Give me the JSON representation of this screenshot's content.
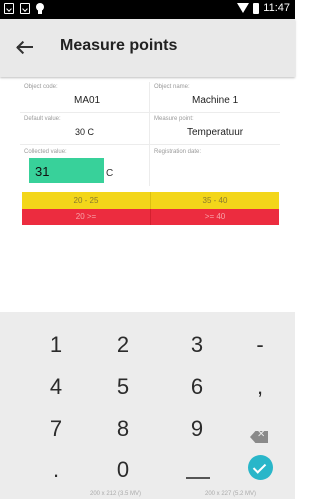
{
  "status_bar": {
    "time": "11:47",
    "left_icons": [
      "screenshot-icon",
      "screenshot-icon",
      "bulb-icon"
    ],
    "right_icons": [
      "wifi-icon",
      "battery-icon"
    ]
  },
  "app_bar": {
    "title": "Measure points",
    "back_icon": "arrow-left-icon"
  },
  "fields": {
    "object_code": {
      "label": "Object code:",
      "value": "MA01"
    },
    "object_name": {
      "label": "Object name:",
      "value": "Machine 1"
    },
    "default_value": {
      "label": "Default value:",
      "value": "30 C"
    },
    "measure_point": {
      "label": "Measure point:",
      "value": "Temperatuur"
    },
    "collected_value": {
      "label": "Collected value:",
      "value": "31",
      "unit": "C"
    },
    "registration_date": {
      "label": "Registration date:",
      "value": ""
    }
  },
  "ranges": {
    "yellow": [
      "20 - 25",
      "35 - 40"
    ],
    "red": [
      "20 >=",
      ">= 40"
    ],
    "colors": {
      "input_ok": "#38d19a",
      "warning": "#f3d61a",
      "danger": "#ec2c3f"
    }
  },
  "keypad": {
    "keys": [
      [
        "1",
        "2",
        "3",
        "-"
      ],
      [
        "4",
        "5",
        "6",
        ","
      ],
      [
        "7",
        "8",
        "9",
        "backspace"
      ],
      [
        ".",
        "0",
        "space",
        "done"
      ]
    ],
    "labels": {
      "k1": "1",
      "k2": "2",
      "k3": "3",
      "minus": "-",
      "k4": "4",
      "k5": "5",
      "k6": "6",
      "comma": ",",
      "k7": "7",
      "k8": "8",
      "k9": "9",
      "dot": ".",
      "k0": "0"
    },
    "accent": "#29b6c9"
  },
  "bottom_strip": {
    "left": "200 x 212 (3.5 MV)",
    "right": "200 x 227 (5.2 MV)"
  }
}
